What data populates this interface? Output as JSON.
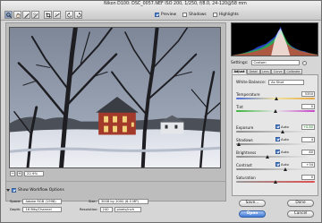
{
  "window": {
    "title": "Nikon D100:  DSC_0057.NEF  ISO 200, 1/250, f/8.0, 24-120@58 mm"
  },
  "toolbar": {
    "tools": [
      "zoom-icon",
      "hand-icon",
      "white-balance-icon",
      "color-sampler-icon",
      "crop-icon",
      "straighten-icon",
      "rotate-left-icon",
      "rotate-right-icon"
    ],
    "preview_label": "Preview",
    "preview_checked": true,
    "shadows_label": "Shadows",
    "shadows_checked": false,
    "highlights_label": "Highlights",
    "highlights_checked": false
  },
  "zoom": {
    "minus": "−",
    "plus": "+",
    "value": "22.9%"
  },
  "workflow": {
    "show_label": "Show Workflow Options",
    "show_checked": true,
    "space_label": "Space:",
    "space_value": "Adobe RGB (1998)",
    "depth_label": "Depth:",
    "depth_value": "16 Bits/Channel",
    "size_label": "Size:",
    "size_value": "3008 by 2000  (6.0 MP)",
    "resolution_label": "Resolution:",
    "resolution_value": "240",
    "resolution_unit": "pixels/inch"
  },
  "settings": {
    "label": "Settings:",
    "value": "Custom"
  },
  "tabs": [
    "Adjust",
    "Detail",
    "Lens",
    "Curve",
    "Calibrate"
  ],
  "adjust": {
    "white_balance_label": "White Balance:",
    "white_balance_value": "As Shot",
    "temperature_label": "Temperature",
    "temperature_value": "5350",
    "temperature_level": 0.52,
    "tint_label": "Tint",
    "tint_value": "0",
    "tint_level": 0.5,
    "exposure_label": "Exposure",
    "exposure_auto": "Auto",
    "exposure_value": "+0.80",
    "exposure_level": 0.6,
    "shadows_label": "Shadows",
    "shadows_auto": "Auto",
    "shadows_value": "4",
    "shadows_level": 0.04,
    "brightness_label": "Brightness",
    "brightness_auto": "Auto",
    "brightness_value": "60",
    "brightness_level": 0.4,
    "contrast_label": "Contrast",
    "contrast_auto": "Auto",
    "contrast_value": "+34",
    "contrast_level": 0.63,
    "saturation_label": "Saturation",
    "saturation_value": "0",
    "saturation_level": 0.5
  },
  "buttons": {
    "save": "Save...",
    "done": "Done",
    "open": "Open",
    "cancel": "Cancel"
  },
  "colors": {
    "accent": "#3f78d6",
    "exposure_text": "#0a7a0a"
  }
}
